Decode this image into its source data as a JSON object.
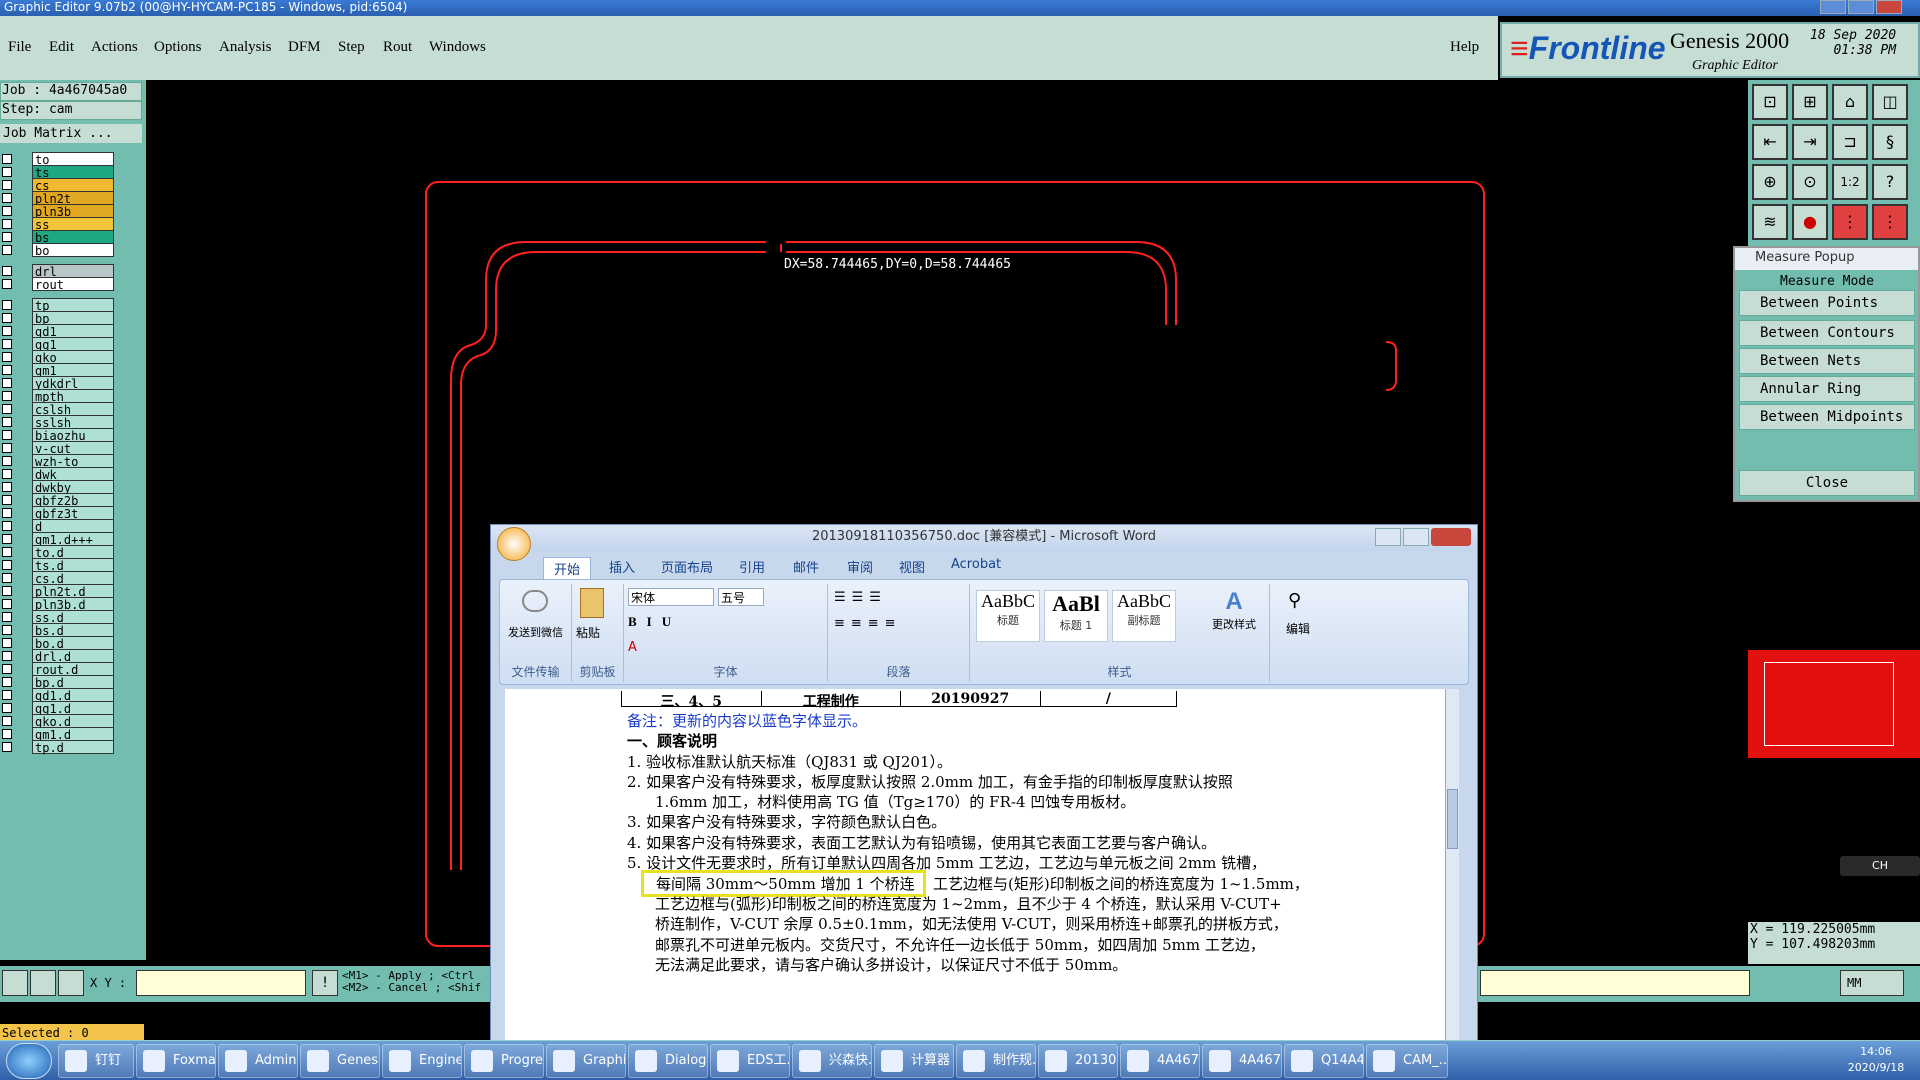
{
  "window": {
    "title": "Graphic Editor 9.07b2 (00@HY-HYCAM-PC185 - Windows, pid:6504)"
  },
  "menu": [
    "File",
    "Edit",
    "Actions",
    "Options",
    "Analysis",
    "DFM",
    "Step",
    "Rout",
    "Windows"
  ],
  "help": "Help",
  "brand": {
    "logo": "Frontline",
    "product": "Genesis 2000",
    "subtitle": "Graphic Editor",
    "date": "18 Sep 2020",
    "time": "01:38 PM"
  },
  "job": {
    "job": "Job : 4a467045a0",
    "step": "Step: cam",
    "matrix": "Job Matrix ..."
  },
  "layers": [
    {
      "name": "to",
      "color": "#ffffff"
    },
    {
      "name": "ts",
      "color": "#1fa884"
    },
    {
      "name": "cs",
      "color": "#f2b830"
    },
    {
      "name": "pln2t",
      "color": "#e0a820"
    },
    {
      "name": "pln3b",
      "color": "#e0a820"
    },
    {
      "name": "ss",
      "color": "#f2c43a"
    },
    {
      "name": "bs",
      "color": "#1fa884"
    },
    {
      "name": "bo",
      "color": "#ffffff"
    },
    {
      "name": "drl",
      "color": "#b7c7c7"
    },
    {
      "name": "rout",
      "color": "#ffffff"
    },
    {
      "name": "tp",
      "color": "#aee0d6"
    },
    {
      "name": "bp",
      "color": "#aee0d6"
    },
    {
      "name": "gd1",
      "color": "#aee0d6"
    },
    {
      "name": "gg1",
      "color": "#aee0d6"
    },
    {
      "name": "gko",
      "color": "#aee0d6"
    },
    {
      "name": "gm1",
      "color": "#aee0d6"
    },
    {
      "name": "ydkdrl",
      "color": "#aee0d6"
    },
    {
      "name": "mpth",
      "color": "#aee0d6"
    },
    {
      "name": "cslsh",
      "color": "#aee0d6"
    },
    {
      "name": "sslsh",
      "color": "#aee0d6"
    },
    {
      "name": "biaozhu",
      "color": "#aee0d6"
    },
    {
      "name": "v-cut",
      "color": "#aee0d6"
    },
    {
      "name": "wzh-to",
      "color": "#aee0d6"
    },
    {
      "name": "dwk",
      "color": "#aee0d6"
    },
    {
      "name": "dwkby",
      "color": "#aee0d6"
    },
    {
      "name": "gbfz2b",
      "color": "#aee0d6"
    },
    {
      "name": "gbfz3t",
      "color": "#aee0d6"
    },
    {
      "name": "d",
      "color": "#aee0d6"
    },
    {
      "name": "gm1.d+++",
      "color": "#aee0d6"
    },
    {
      "name": "to.d",
      "color": "#aee0d6"
    },
    {
      "name": "ts.d",
      "color": "#aee0d6"
    },
    {
      "name": "cs.d",
      "color": "#aee0d6"
    },
    {
      "name": "pln2t.d",
      "color": "#aee0d6"
    },
    {
      "name": "pln3b.d",
      "color": "#aee0d6"
    },
    {
      "name": "ss.d",
      "color": "#aee0d6"
    },
    {
      "name": "bs.d",
      "color": "#aee0d6"
    },
    {
      "name": "bo.d",
      "color": "#aee0d6"
    },
    {
      "name": "drl.d",
      "color": "#aee0d6"
    },
    {
      "name": "rout.d",
      "color": "#aee0d6"
    },
    {
      "name": "bp.d",
      "color": "#aee0d6"
    },
    {
      "name": "gd1.d",
      "color": "#aee0d6"
    },
    {
      "name": "gg1.d",
      "color": "#aee0d6"
    },
    {
      "name": "gko.d",
      "color": "#aee0d6"
    },
    {
      "name": "gm1.d",
      "color": "#aee0d6"
    },
    {
      "name": "tp.d",
      "color": "#aee0d6"
    }
  ],
  "selected": "Selected : 0",
  "measure_text": "DX=58.744465,DY=0,D=58.744465",
  "measure_popup": {
    "title": "Measure Popup",
    "mode": "Measure Mode",
    "options": [
      "Between Points",
      "Between Contours",
      "Between Nets",
      "Annular Ring",
      "Between Midpoints"
    ],
    "close": "Close"
  },
  "coords": {
    "x": "X = 119.225005mm",
    "y": "Y = 107.498203mm"
  },
  "units": "MM",
  "xy_label": "X Y :",
  "hints": {
    "l1": "<M1> - Apply  ; <Ctrl",
    "l2": "<M2> - Cancel ; <Shif"
  },
  "word": {
    "title": "20130918110356750.doc [兼容模式] - Microsoft Word",
    "tabs": [
      "开始",
      "插入",
      "页面布局",
      "引用",
      "邮件",
      "审阅",
      "视图",
      "Acrobat"
    ],
    "groups": {
      "send": "发送到微信",
      "send_group": "文件传输",
      "paste": "粘贴",
      "clipboard": "剪贴板",
      "font": "字体",
      "para": "段落",
      "styles": "样式",
      "change": "更改样式",
      "edit": "编辑"
    },
    "font_name": "宋体",
    "font_size": "五号",
    "styles": [
      {
        "sample": "AaBbC",
        "name": "标题"
      },
      {
        "sample": "AaBl",
        "name": "标题 1"
      },
      {
        "sample": "AaBbC",
        "name": "副标题"
      }
    ],
    "table_row": [
      "三、4、5",
      "工程制作",
      "20190927",
      "/"
    ],
    "lines": [
      "备注：更新的内容以蓝色字体显示。",
      "一、顾客说明",
      "1.  验收标准默认航天标准（QJ831 或 QJ201）。",
      "2.  如果客户没有特殊要求，板厚度默认按照 2.0mm 加工，有金手指的印制板厚度默认按照",
      "1.6mm 加工，材料使用高 TG 值（Tg≥170）的 FR-4 凹蚀专用板材。",
      "3.  如果客户没有特殊要求，字符颜色默认白色。",
      "4.  如果客户没有特殊要求，表面工艺默认为有铅喷锡，使用其它表面工艺要与客户确认。",
      "5.  设计文件无要求时，所有订单默认四周各加 5mm 工艺边，工艺边与单元板之间 2mm 铣槽，",
      "每间隔 30mm～50mm 增加 1 个桥连",
      "工艺边框与(矩形)印制板之间的桥连宽度为 1~1.5mm，",
      "工艺边框与(弧形)印制板之间的桥连宽度为 1~2mm，且不少于 4 个桥连，默认采用 V-CUT+",
      "桥连制作，V-CUT 余厚 0.5±0.1mm，如无法使用 V-CUT，则采用桥连+邮票孔的拼板方式，",
      "邮票孔不可进单元板内。交货尺寸，不允许任一边长低于 50mm，如四周加 5mm 工艺边，",
      "无法满足此要求，请与客户确认多拼设计，以保证尺寸不低于 50mm。"
    ]
  },
  "taskbar": {
    "items": [
      "钉钉",
      "Foxmail",
      "Admini...",
      "Genesis",
      "Engine...",
      "Progre...",
      "Graphi...",
      "Dialog...",
      "EDS工...",
      "兴森快...",
      "计算器",
      "制作规...",
      "20130...",
      "4A467...",
      "4A467...",
      "Q14A4...",
      "CAM_..."
    ],
    "time": "14:06",
    "date": "2020/9/18",
    "ime": "CH"
  }
}
